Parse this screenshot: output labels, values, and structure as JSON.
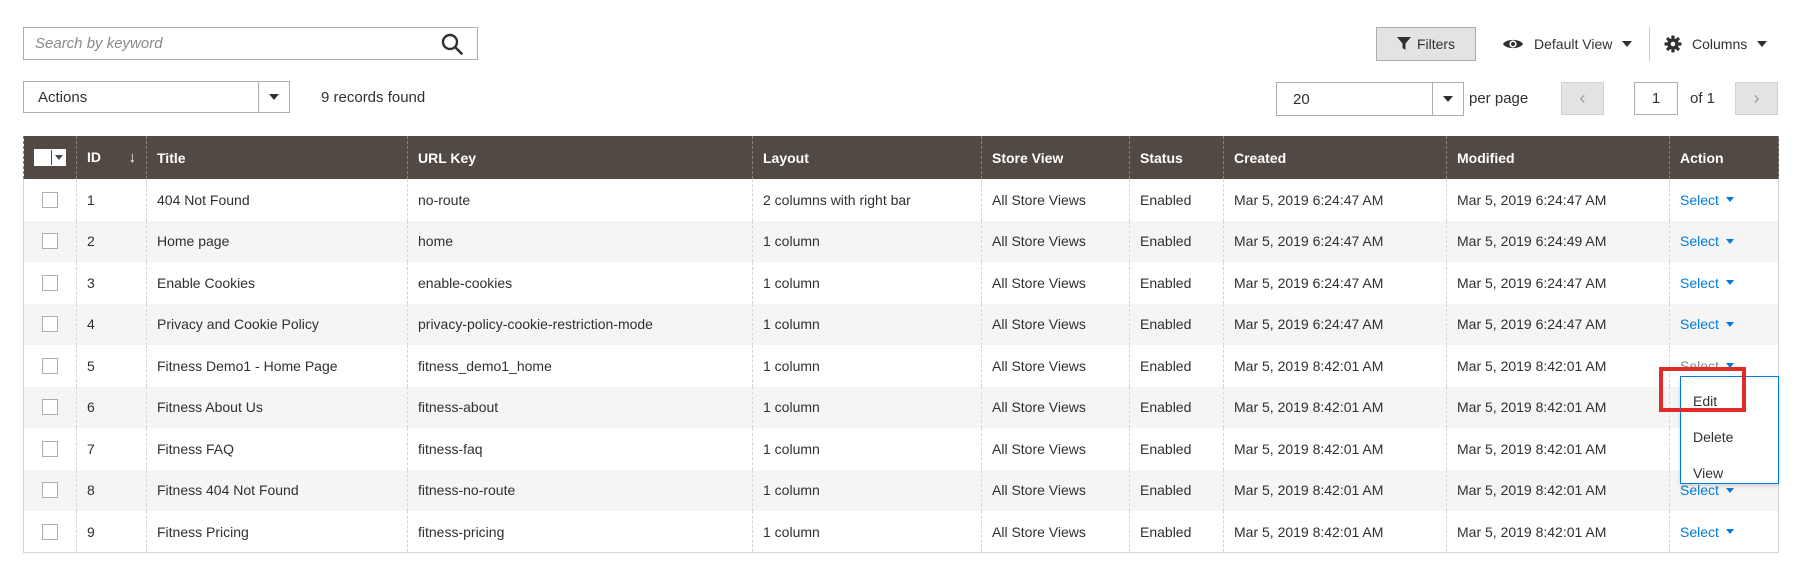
{
  "search": {
    "placeholder": "Search by keyword",
    "value": ""
  },
  "toolbar": {
    "filters_label": "Filters",
    "view_label": "Default View",
    "columns_label": "Columns"
  },
  "actions": {
    "label": "Actions"
  },
  "records_found": "9 records found",
  "pagination": {
    "per_page_value": "20",
    "per_page_label": "per page",
    "prev": "‹",
    "next": "›",
    "current_page": "1",
    "of_pages": "of 1"
  },
  "grid": {
    "headers": [
      "ID",
      "Title",
      "URL Key",
      "Layout",
      "Store View",
      "Status",
      "Created",
      "Modified",
      "Action"
    ],
    "sort_indicator": "↓",
    "rows": [
      {
        "id": "1",
        "title": "404 Not Found",
        "url_key": "no-route",
        "layout": "2 columns with right bar",
        "store_view": "All Store Views",
        "status": "Enabled",
        "created": "Mar 5, 2019 6:24:47 AM",
        "modified": "Mar 5, 2019 6:24:47 AM",
        "action": "Select"
      },
      {
        "id": "2",
        "title": "Home page",
        "url_key": "home",
        "layout": "1 column",
        "store_view": "All Store Views",
        "status": "Enabled",
        "created": "Mar 5, 2019 6:24:47 AM",
        "modified": "Mar 5, 2019 6:24:49 AM",
        "action": "Select"
      },
      {
        "id": "3",
        "title": "Enable Cookies",
        "url_key": "enable-cookies",
        "layout": "1 column",
        "store_view": "All Store Views",
        "status": "Enabled",
        "created": "Mar 5, 2019 6:24:47 AM",
        "modified": "Mar 5, 2019 6:24:47 AM",
        "action": "Select"
      },
      {
        "id": "4",
        "title": "Privacy and Cookie Policy",
        "url_key": "privacy-policy-cookie-restriction-mode",
        "layout": "1 column",
        "store_view": "All Store Views",
        "status": "Enabled",
        "created": "Mar 5, 2019 6:24:47 AM",
        "modified": "Mar 5, 2019 6:24:47 AM",
        "action": "Select"
      },
      {
        "id": "5",
        "title": "Fitness Demo1 - Home Page",
        "url_key": "fitness_demo1_home",
        "layout": "1 column",
        "store_view": "All Store Views",
        "status": "Enabled",
        "created": "Mar 5, 2019 8:42:01 AM",
        "modified": "Mar 5, 2019 8:42:01 AM",
        "action": "Select"
      },
      {
        "id": "6",
        "title": "Fitness About Us",
        "url_key": "fitness-about",
        "layout": "1 column",
        "store_view": "All Store Views",
        "status": "Enabled",
        "created": "Mar 5, 2019 8:42:01 AM",
        "modified": "Mar 5, 2019 8:42:01 AM",
        "action": ""
      },
      {
        "id": "7",
        "title": "Fitness FAQ",
        "url_key": "fitness-faq",
        "layout": "1 column",
        "store_view": "All Store Views",
        "status": "Enabled",
        "created": "Mar 5, 2019 8:42:01 AM",
        "modified": "Mar 5, 2019 8:42:01 AM",
        "action": ""
      },
      {
        "id": "8",
        "title": "Fitness 404 Not Found",
        "url_key": "fitness-no-route",
        "layout": "1 column",
        "store_view": "All Store Views",
        "status": "Enabled",
        "created": "Mar 5, 2019 8:42:01 AM",
        "modified": "Mar 5, 2019 8:42:01 AM",
        "action": "Select"
      },
      {
        "id": "9",
        "title": "Fitness Pricing",
        "url_key": "fitness-pricing",
        "layout": "1 column",
        "store_view": "All Store Views",
        "status": "Enabled",
        "created": "Mar 5, 2019 8:42:01 AM",
        "modified": "Mar 5, 2019 8:42:01 AM",
        "action": "Select"
      }
    ]
  },
  "action_menu": {
    "items": [
      "Edit",
      "Delete",
      "View"
    ]
  },
  "colors": {
    "header_bg": "#514943",
    "link": "#007bdb",
    "highlight": "#e02b27"
  }
}
